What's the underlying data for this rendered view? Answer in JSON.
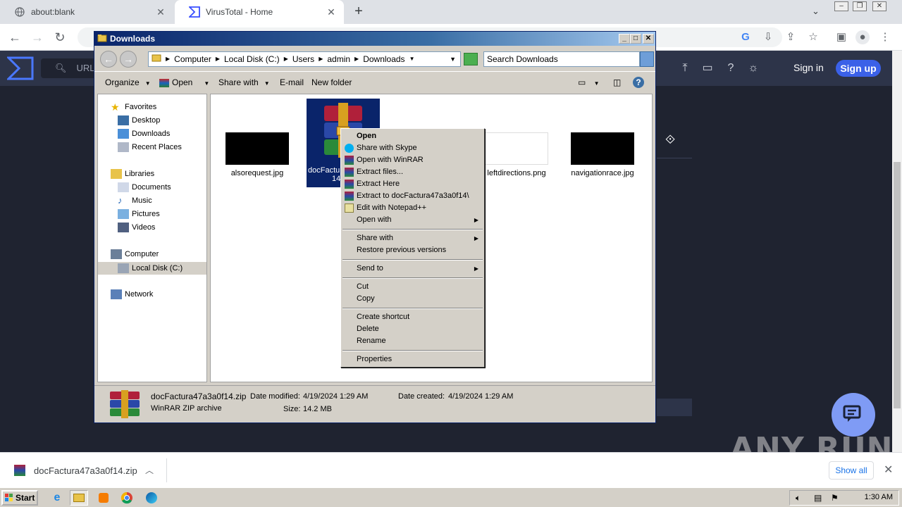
{
  "browser": {
    "tabs": [
      {
        "label": "about:blank"
      },
      {
        "label": "VirusTotal - Home"
      }
    ],
    "new_tab": "+",
    "url_partial": "URL"
  },
  "virustotal": {
    "signin": "Sign in",
    "signup": "Sign up"
  },
  "explorer": {
    "title": "Downloads",
    "breadcrumb": [
      "Computer",
      "Local Disk (C:)",
      "Users",
      "admin",
      "Downloads"
    ],
    "search_placeholder": "Search Downloads",
    "commands": {
      "organize": "Organize",
      "open": "Open",
      "share_with": "Share with",
      "email": "E-mail",
      "new_folder": "New folder"
    },
    "nav": {
      "favorites": "Favorites",
      "desktop": "Desktop",
      "downloads": "Downloads",
      "recent_places": "Recent Places",
      "libraries": "Libraries",
      "documents": "Documents",
      "music": "Music",
      "pictures": "Pictures",
      "videos": "Videos",
      "computer": "Computer",
      "local_disk": "Local Disk (C:)",
      "network": "Network"
    },
    "files": {
      "alsorequest": "alsorequest.jpg",
      "zip_partial": "docFactu",
      "zip_partial2": "14",
      "leftdirections": "leftdirections.png",
      "navigationrace": "navigationrace.jpg"
    },
    "details": {
      "filename": "docFactura47a3a0f14.zip",
      "type": "WinRAR ZIP archive",
      "date_modified_label": "Date modified:",
      "date_modified": "4/19/2024 1:29 AM",
      "date_created_label": "Date created:",
      "date_created": "4/19/2024 1:29 AM",
      "size_label": "Size:",
      "size": "14.2 MB"
    }
  },
  "context_menu": {
    "open": "Open",
    "share_skype": "Share with Skype",
    "open_winrar": "Open with WinRAR",
    "extract_files": "Extract files...",
    "extract_here": "Extract Here",
    "extract_to": "Extract to docFactura47a3a0f14\\",
    "edit_npp": "Edit with Notepad++",
    "open_with": "Open with",
    "share_with": "Share with",
    "restore": "Restore previous versions",
    "send_to": "Send to",
    "cut": "Cut",
    "copy": "Copy",
    "create_shortcut": "Create shortcut",
    "delete": "Delete",
    "rename": "Rename",
    "properties": "Properties"
  },
  "download_bar": {
    "filename": "docFactura47a3a0f14.zip",
    "show_all": "Show all"
  },
  "taskbar": {
    "start": "Start",
    "clock": "1:30 AM"
  },
  "watermark": "ANY RUN",
  "colors": {
    "vt_bg": "#1f2330",
    "vt_header": "#2d3449",
    "vt_accent": "#3b61e8",
    "selection": "#0a246a"
  }
}
